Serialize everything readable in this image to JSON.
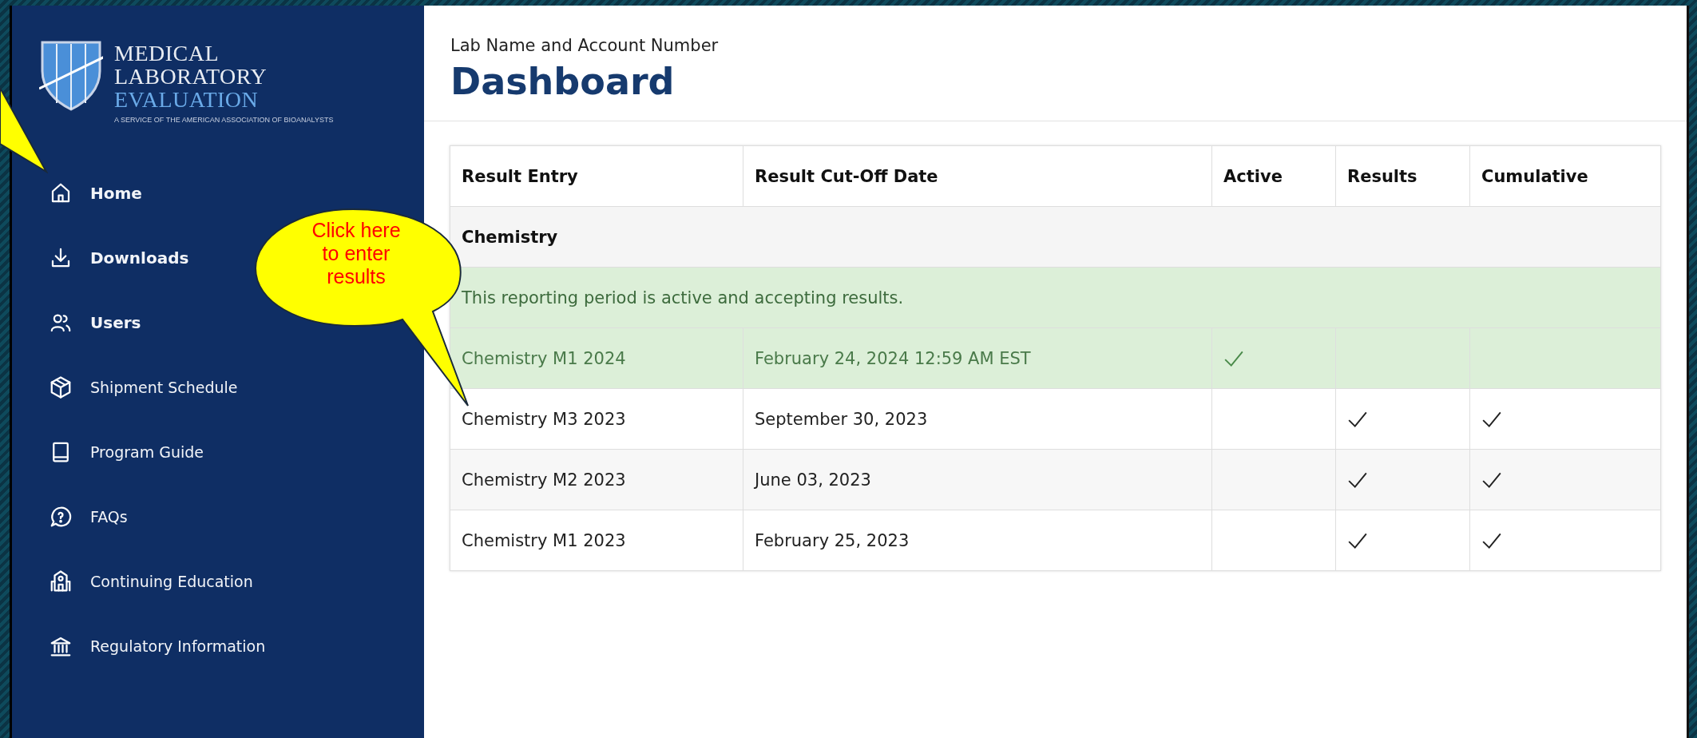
{
  "logo": {
    "lines": [
      "MEDICAL",
      "LABORATORY",
      "EVALUATION"
    ],
    "tagline": "A SERVICE OF THE AMERICAN ASSOCIATION OF BIOANALYSTS"
  },
  "sidebar": {
    "items": [
      {
        "label": "Home",
        "kind": "home",
        "bold": true
      },
      {
        "label": "Downloads",
        "kind": "download",
        "bold": true
      },
      {
        "label": "Users",
        "kind": "users",
        "bold": true
      },
      {
        "label": "Shipment Schedule",
        "kind": "box",
        "bold": false
      },
      {
        "label": "Program Guide",
        "kind": "book",
        "bold": false
      },
      {
        "label": "FAQs",
        "kind": "question",
        "bold": false
      },
      {
        "label": "Continuing Education",
        "kind": "school",
        "bold": false
      },
      {
        "label": "Regulatory Information",
        "kind": "bank",
        "bold": false
      }
    ]
  },
  "header": {
    "subtitle": "Lab Name and Account Number",
    "title": "Dashboard"
  },
  "table": {
    "columns": [
      "Result Entry",
      "Result Cut-Off Date",
      "Active",
      "Results",
      "Cumulative"
    ],
    "group": "Chemistry",
    "notice": "This reporting period is active and accepting results.",
    "rows": [
      {
        "entry": "Chemistry M1 2024",
        "date": "February 24, 2024 12:59 AM EST",
        "active": true,
        "results": false,
        "cumulative": false
      },
      {
        "entry": "Chemistry M3 2023",
        "date": "September 30, 2023",
        "active": false,
        "results": true,
        "cumulative": true
      },
      {
        "entry": "Chemistry M2 2023",
        "date": "June 03, 2023",
        "active": false,
        "results": true,
        "cumulative": true
      },
      {
        "entry": "Chemistry M1 2023",
        "date": "February 25, 2023",
        "active": false,
        "results": true,
        "cumulative": true
      }
    ]
  },
  "callout": {
    "lines": [
      "Click here",
      "to enter",
      "results"
    ]
  }
}
